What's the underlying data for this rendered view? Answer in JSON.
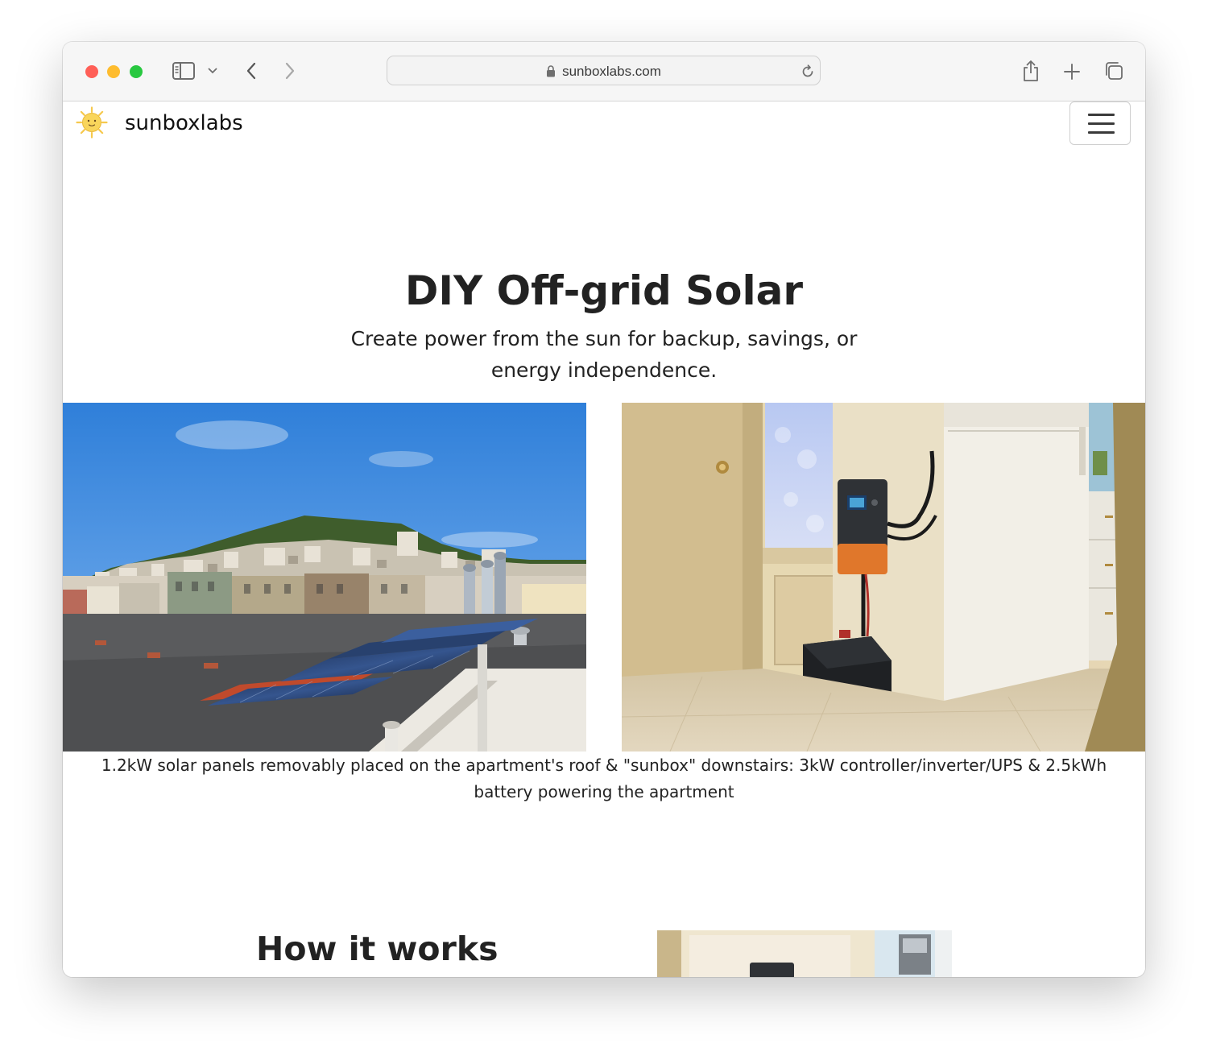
{
  "browser": {
    "url": "sunboxlabs.com",
    "icons": {
      "sidebar": "sidebar-icon",
      "back": "chevron-left-icon",
      "forward": "chevron-right-icon",
      "lock": "lock-icon",
      "reload": "reload-icon",
      "share": "share-icon",
      "new_tab": "plus-icon",
      "tabs": "tabs-icon"
    },
    "traffic_colors": [
      "#ff5f57",
      "#febc2e",
      "#28c840"
    ]
  },
  "navbar": {
    "brand": "sunboxlabs",
    "logo_icon": "sun-icon",
    "menu_icon": "hamburger-menu-icon"
  },
  "hero": {
    "title": "DIY Off-grid Solar",
    "subtitle": "Create power from the sun for backup, savings, or energy independence."
  },
  "gallery": {
    "caption": "1.2kW solar panels removably placed on the apartment's roof & \"sunbox\" downstairs: 3kW controller/inverter/UPS & 2.5kWh battery powering the apartment"
  },
  "how_it_works": {
    "title": "How it works"
  }
}
